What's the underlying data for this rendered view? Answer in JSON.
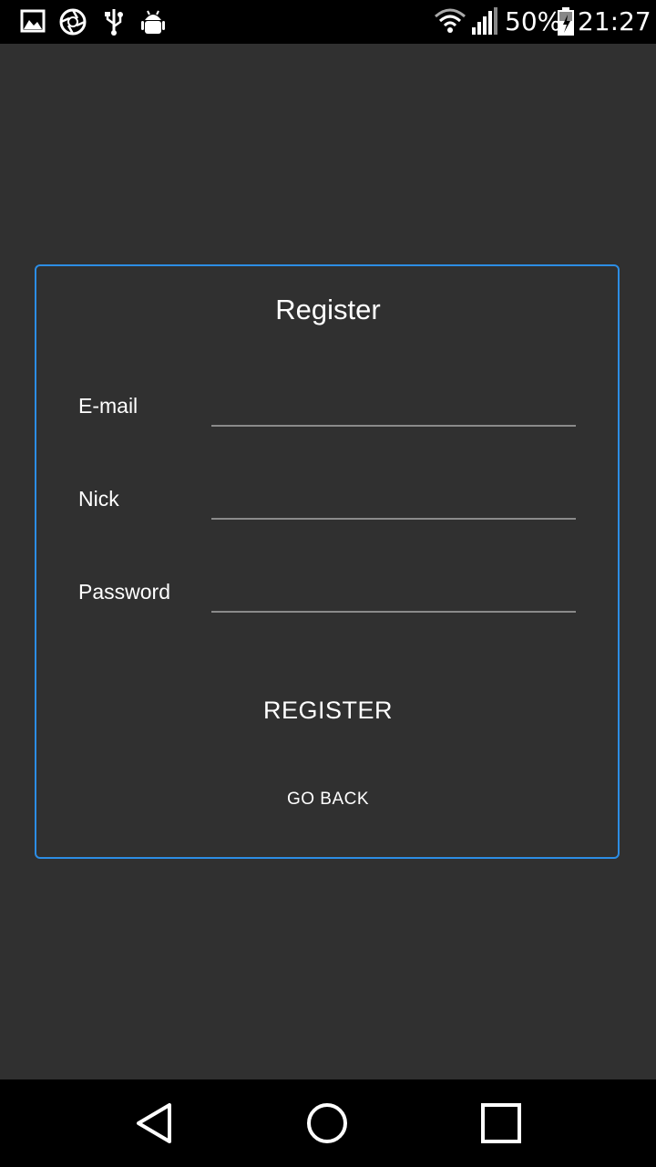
{
  "status_bar": {
    "battery_percent": "50%",
    "time": "21:27",
    "left_icons": [
      "gallery-icon",
      "aperture-icon",
      "usb-icon",
      "android-debug-icon"
    ],
    "right_icons": [
      "wifi-icon",
      "signal-icon",
      "battery-charging-icon"
    ]
  },
  "form": {
    "title": "Register",
    "fields": [
      {
        "label": "E-mail",
        "value": "",
        "placeholder": ""
      },
      {
        "label": "Nick",
        "value": "",
        "placeholder": ""
      },
      {
        "label": "Password",
        "value": "",
        "placeholder": ""
      }
    ],
    "register_label": "REGISTER",
    "back_label": "GO BACK",
    "accent_color": "#2c8de4"
  },
  "nav_bar": {
    "icons": [
      "back-triangle-icon",
      "home-circle-icon",
      "recents-square-icon"
    ]
  },
  "colors": {
    "background": "#303030",
    "bars": "#000000",
    "underline": "#8a8a8a"
  }
}
